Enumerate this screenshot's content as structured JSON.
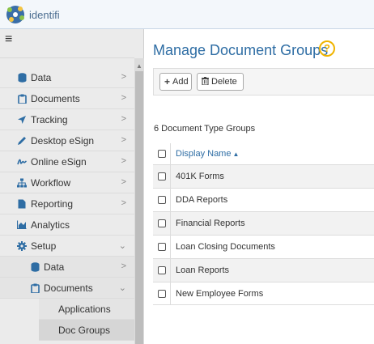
{
  "app": {
    "logo_text": "identifi"
  },
  "sidebar": {
    "menu_glyph": "≡",
    "items": [
      {
        "label": "Data",
        "icon": "database-icon",
        "chevron": ">"
      },
      {
        "label": "Documents",
        "icon": "clipboard-icon",
        "chevron": ">"
      },
      {
        "label": "Tracking",
        "icon": "location-arrow-icon",
        "chevron": ">"
      },
      {
        "label": "Desktop eSign",
        "icon": "pencil-icon",
        "chevron": ">"
      },
      {
        "label": "Online eSign",
        "icon": "signature-icon",
        "chevron": ">"
      },
      {
        "label": "Workflow",
        "icon": "sitemap-icon",
        "chevron": ">"
      },
      {
        "label": "Reporting",
        "icon": "file-icon",
        "chevron": ">"
      },
      {
        "label": "Analytics",
        "icon": "area-chart-icon"
      },
      {
        "label": "Setup",
        "icon": "gear-icon",
        "chevron": "⌄"
      }
    ],
    "setup_children": [
      {
        "label": "Data",
        "icon": "database-icon",
        "chevron": ">"
      },
      {
        "label": "Documents",
        "icon": "clipboard-icon",
        "chevron": "⌄"
      }
    ],
    "documents_children": [
      {
        "label": "Applications"
      },
      {
        "label": "Doc Groups"
      }
    ]
  },
  "main": {
    "title": "Manage Document Groups",
    "help_glyph": "?",
    "toolbar": {
      "add_label": "Add",
      "add_glyph": "+",
      "delete_label": "Delete",
      "delete_glyph": "🗑"
    },
    "count_label": "6 Document Type Groups",
    "grid": {
      "column_header": "Display Name",
      "sort_glyph": "▲",
      "rows": [
        "401K Forms",
        "DDA Reports",
        "Financial Reports",
        "Loan Closing Documents",
        "Loan Reports",
        "New Employee Forms"
      ]
    }
  },
  "colors": {
    "accent": "#2e6da4",
    "help": "#f0b400",
    "sidebar_bg": "#ebebeb",
    "icon_blue": "#2e6da4"
  }
}
